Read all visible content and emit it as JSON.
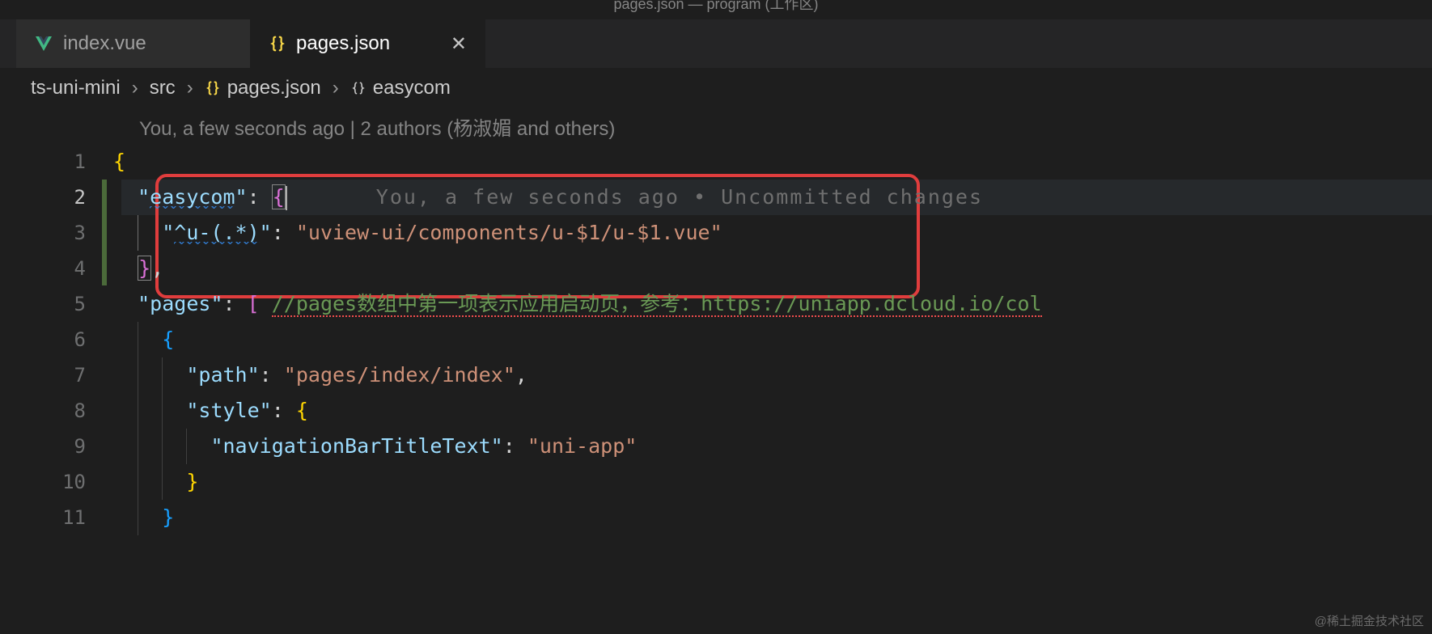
{
  "window": {
    "title": "pages.json — program (工作区)"
  },
  "tabs": [
    {
      "label": "index.vue",
      "icon": "vue-icon",
      "active": false
    },
    {
      "label": "pages.json",
      "icon": "json-icon",
      "active": true,
      "dirty": false
    }
  ],
  "breadcrumb": {
    "segments": [
      "ts-uni-mini",
      "src",
      "pages.json",
      "easycom"
    ]
  },
  "blame": {
    "header": "You, a few seconds ago | 2 authors (杨淑媚 and others)",
    "inline": "You, a few seconds ago • Uncommitted changes"
  },
  "code": {
    "lines": [
      {
        "n": 1
      },
      {
        "n": 2,
        "key": "easycom",
        "active": true
      },
      {
        "n": 3,
        "key": "^u-(.*)",
        "value": "uview-ui/components/u-$1/u-$1.vue"
      },
      {
        "n": 4
      },
      {
        "n": 5,
        "key": "pages",
        "comment": "//pages数组中第一项表示应用启动页，参考：https://uniapp.dcloud.io/col"
      },
      {
        "n": 6
      },
      {
        "n": 7,
        "key": "path",
        "value": "pages/index/index"
      },
      {
        "n": 8,
        "key": "style"
      },
      {
        "n": 9,
        "key": "navigationBarTitleText",
        "value": "uni-app"
      },
      {
        "n": 10
      },
      {
        "n": 11
      }
    ]
  },
  "watermark": "@稀土掘金技术社区"
}
